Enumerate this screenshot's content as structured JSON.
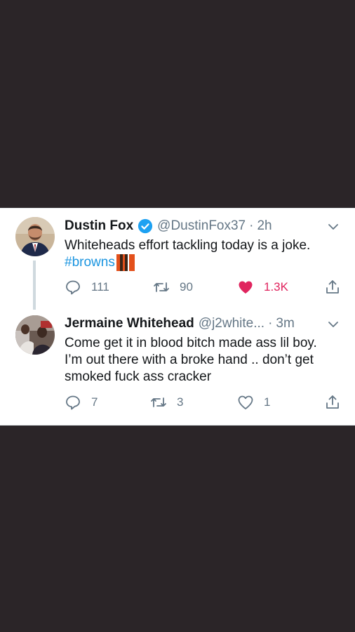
{
  "tweets": [
    {
      "name": "Dustin Fox",
      "verified": true,
      "handle": "@DustinFox37",
      "separator": "·",
      "time": "2h",
      "text": "Whiteheads effort tackling today is a joke.",
      "hashtag": "#browns",
      "reply_count": "111",
      "retweet_count": "90",
      "like_count": "1.3K",
      "liked": true
    },
    {
      "name": "Jermaine Whitehead",
      "verified": false,
      "handle": "@j2white...",
      "separator": "·",
      "time": "3m",
      "text": "Come get it in blood bitch made ass lil boy. I’m out there with a broke hand .. don’t get smoked fuck ass cracker",
      "reply_count": "7",
      "retweet_count": "3",
      "like_count": "1",
      "liked": false
    }
  ],
  "colors": {
    "background": "#2b2528",
    "card": "#ffffff",
    "text": "#14171a",
    "secondary": "#657786",
    "link": "#1b95e0",
    "like": "#e0245e",
    "verified": "#1da1f2"
  },
  "icons": [
    "verified-badge-icon",
    "chevron-down-icon",
    "reply-icon",
    "retweet-icon",
    "like-icon",
    "share-icon"
  ]
}
